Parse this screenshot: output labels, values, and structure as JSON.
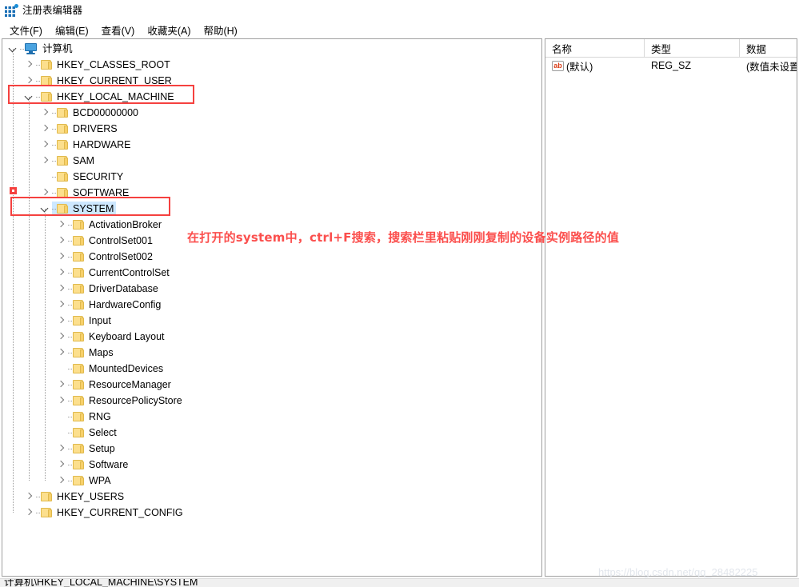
{
  "window": {
    "title": "注册表编辑器",
    "icon": "registry-editor-icon"
  },
  "menu": {
    "items": [
      {
        "label": "文件(F)",
        "name": "menu-file"
      },
      {
        "label": "编辑(E)",
        "name": "menu-edit"
      },
      {
        "label": "查看(V)",
        "name": "menu-view"
      },
      {
        "label": "收藏夹(A)",
        "name": "menu-favorites"
      },
      {
        "label": "帮助(H)",
        "name": "menu-help"
      }
    ]
  },
  "tree": {
    "nodes": [
      {
        "label": "计算机",
        "indent": 0,
        "icon": "computer-icon",
        "chevron": "expanded",
        "selected": false
      },
      {
        "label": "HKEY_CLASSES_ROOT",
        "indent": 1,
        "icon": "folder-icon",
        "chevron": "collapsed",
        "selected": false
      },
      {
        "label": "HKEY_CURRENT_USER",
        "indent": 1,
        "icon": "folder-icon",
        "chevron": "collapsed",
        "selected": false
      },
      {
        "label": "HKEY_LOCAL_MACHINE",
        "indent": 1,
        "icon": "folder-icon",
        "chevron": "expanded",
        "selected": false
      },
      {
        "label": "BCD00000000",
        "indent": 2,
        "icon": "folder-icon",
        "chevron": "collapsed",
        "selected": false
      },
      {
        "label": "DRIVERS",
        "indent": 2,
        "icon": "folder-icon",
        "chevron": "collapsed",
        "selected": false
      },
      {
        "label": "HARDWARE",
        "indent": 2,
        "icon": "folder-icon",
        "chevron": "collapsed",
        "selected": false
      },
      {
        "label": "SAM",
        "indent": 2,
        "icon": "folder-icon",
        "chevron": "collapsed",
        "selected": false
      },
      {
        "label": "SECURITY",
        "indent": 2,
        "icon": "folder-icon",
        "chevron": "none",
        "selected": false
      },
      {
        "label": "SOFTWARE",
        "indent": 2,
        "icon": "folder-icon",
        "chevron": "collapsed",
        "selected": false
      },
      {
        "label": "SYSTEM",
        "indent": 2,
        "icon": "folder-icon",
        "chevron": "expanded",
        "selected": true
      },
      {
        "label": "ActivationBroker",
        "indent": 3,
        "icon": "folder-icon",
        "chevron": "collapsed",
        "selected": false
      },
      {
        "label": "ControlSet001",
        "indent": 3,
        "icon": "folder-icon",
        "chevron": "collapsed",
        "selected": false
      },
      {
        "label": "ControlSet002",
        "indent": 3,
        "icon": "folder-icon",
        "chevron": "collapsed",
        "selected": false
      },
      {
        "label": "CurrentControlSet",
        "indent": 3,
        "icon": "folder-icon",
        "chevron": "collapsed",
        "selected": false
      },
      {
        "label": "DriverDatabase",
        "indent": 3,
        "icon": "folder-icon",
        "chevron": "collapsed",
        "selected": false
      },
      {
        "label": "HardwareConfig",
        "indent": 3,
        "icon": "folder-icon",
        "chevron": "collapsed",
        "selected": false
      },
      {
        "label": "Input",
        "indent": 3,
        "icon": "folder-icon",
        "chevron": "collapsed",
        "selected": false
      },
      {
        "label": "Keyboard Layout",
        "indent": 3,
        "icon": "folder-icon",
        "chevron": "collapsed",
        "selected": false
      },
      {
        "label": "Maps",
        "indent": 3,
        "icon": "folder-icon",
        "chevron": "collapsed",
        "selected": false
      },
      {
        "label": "MountedDevices",
        "indent": 3,
        "icon": "folder-icon",
        "chevron": "none",
        "selected": false
      },
      {
        "label": "ResourceManager",
        "indent": 3,
        "icon": "folder-icon",
        "chevron": "collapsed",
        "selected": false
      },
      {
        "label": "ResourcePolicyStore",
        "indent": 3,
        "icon": "folder-icon",
        "chevron": "collapsed",
        "selected": false
      },
      {
        "label": "RNG",
        "indent": 3,
        "icon": "folder-icon",
        "chevron": "none",
        "selected": false
      },
      {
        "label": "Select",
        "indent": 3,
        "icon": "folder-icon",
        "chevron": "none",
        "selected": false
      },
      {
        "label": "Setup",
        "indent": 3,
        "icon": "folder-icon",
        "chevron": "collapsed",
        "selected": false
      },
      {
        "label": "Software",
        "indent": 3,
        "icon": "folder-icon",
        "chevron": "collapsed",
        "selected": false
      },
      {
        "label": "WPA",
        "indent": 3,
        "icon": "folder-icon",
        "chevron": "collapsed",
        "selected": false
      },
      {
        "label": "HKEY_USERS",
        "indent": 1,
        "icon": "folder-icon",
        "chevron": "collapsed",
        "selected": false
      },
      {
        "label": "HKEY_CURRENT_CONFIG",
        "indent": 1,
        "icon": "folder-icon",
        "chevron": "collapsed",
        "selected": false
      }
    ]
  },
  "list": {
    "columns": [
      "名称",
      "类型",
      "数据"
    ],
    "rows": [
      {
        "name": "(默认)",
        "type": "REG_SZ",
        "data": "(数值未设置)",
        "icon": "string-value-icon"
      }
    ]
  },
  "annotations": {
    "note": "在打开的system中，ctrl+F搜索，搜索栏里粘贴刚刚复制的设备实例路径的值",
    "highlight_color": "#f5413f",
    "boxes": [
      {
        "name": "hkey-local-machine-highlight"
      },
      {
        "name": "system-highlight"
      }
    ],
    "marker": {
      "name": "software-marker"
    }
  },
  "watermark": {
    "text": "https://blog.csdn.net/qq_28482225"
  },
  "statusbar": {
    "path": "计算机\\HKEY_LOCAL_MACHINE\\SYSTEM"
  }
}
